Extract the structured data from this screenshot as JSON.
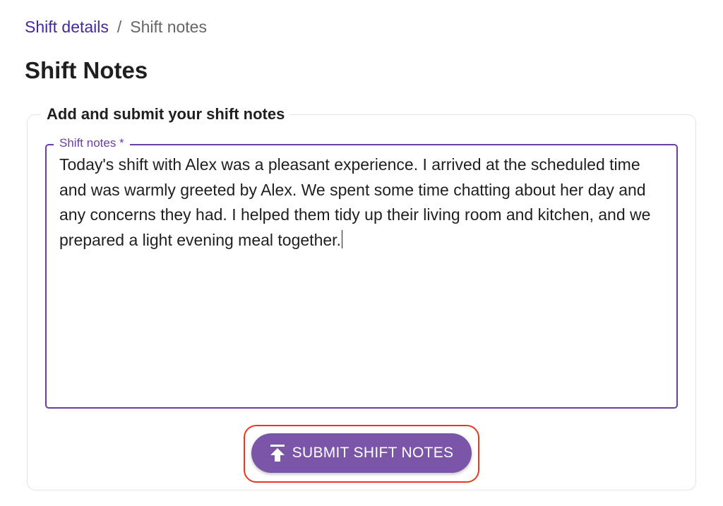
{
  "breadcrumb": {
    "parent_label": "Shift details",
    "separator": "/",
    "current_label": "Shift notes"
  },
  "page": {
    "title": "Shift Notes"
  },
  "card": {
    "legend": "Add and submit your shift notes"
  },
  "notes_field": {
    "label": "Shift notes *",
    "value": "Today's shift with Alex was a pleasant experience. I arrived at the scheduled time and was warmly greeted by Alex. We spent some time chatting about her day and any concerns they had. I helped them tidy up their living room and kitchen, and we prepared a light evening meal together."
  },
  "submit": {
    "label": "SUBMIT SHIFT NOTES",
    "icon": "upload-icon"
  },
  "colors": {
    "accent": "#6a3fa0",
    "button": "#7b55a8",
    "link": "#4527a0",
    "highlight": "#e5381f"
  }
}
